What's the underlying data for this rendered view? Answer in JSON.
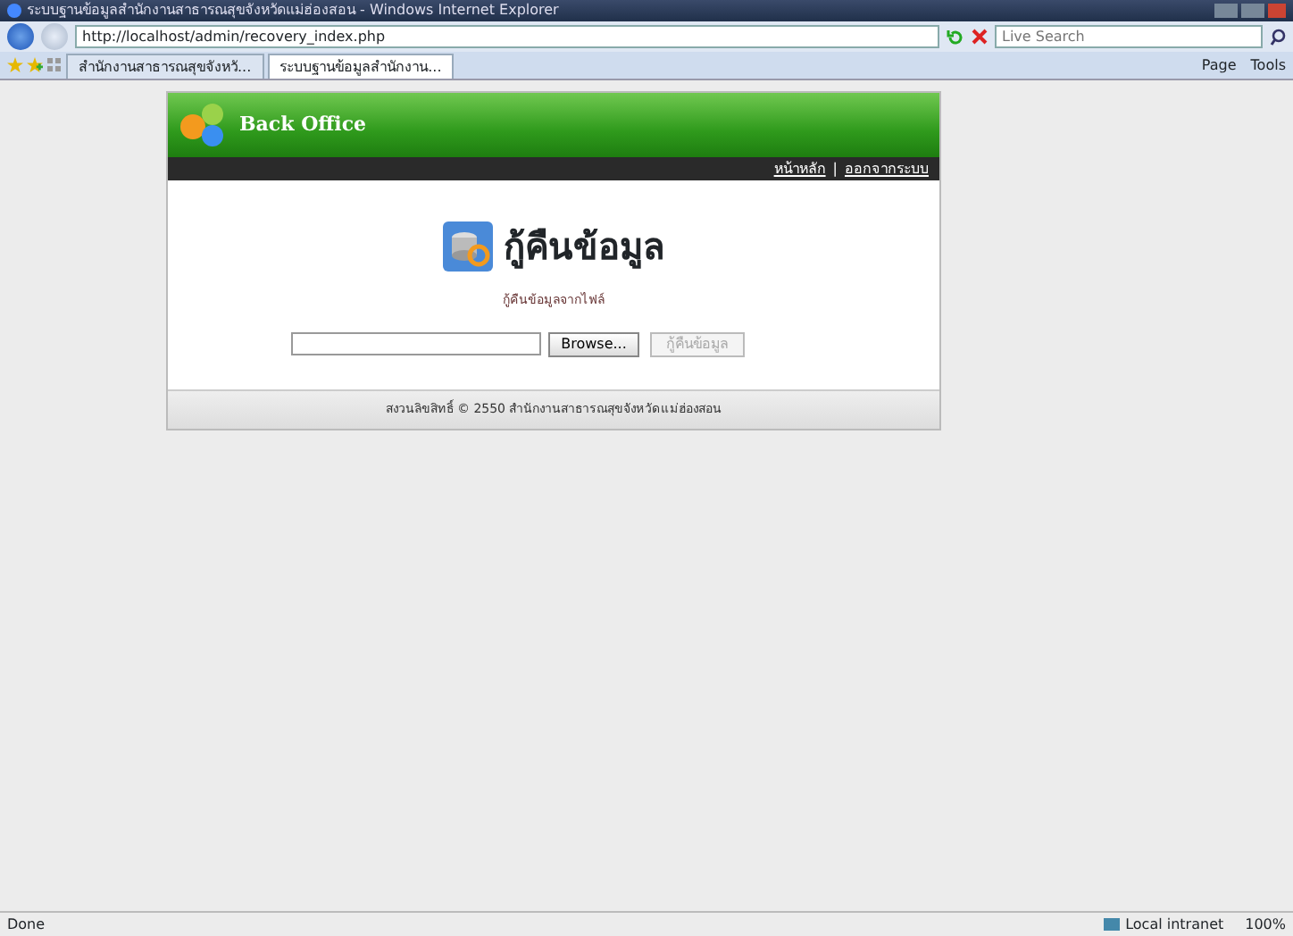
{
  "window": {
    "title": "ระบบฐานข้อมูลสำนักงานสาธารณสุขจังหวัดแม่ฮ่องสอน - Windows Internet Explorer"
  },
  "address_bar": {
    "url": "http://localhost/admin/recovery_index.php",
    "search_placeholder": "Live Search"
  },
  "tabs": [
    {
      "label": "สำนักงานสาธารณสุขจังหวั...",
      "selected": false
    },
    {
      "label": "ระบบฐานข้อมูลสำนักงาน...",
      "selected": true
    }
  ],
  "command_bar": [
    "Page",
    "Tools"
  ],
  "page": {
    "brand": "Back Office",
    "nav_links": [
      "หน้าหลัก",
      "ออกจากระบบ"
    ],
    "nav_separator": "|",
    "heading": "กู้คืนข้อมูล",
    "subtitle": "กู้คืนข้อมูลจากไฟล์",
    "file_input": {
      "button": "Browse..."
    },
    "submit": {
      "label": "กู้คืนข้อมูล",
      "disabled": true
    },
    "footer": "สงวนลิขสิทธิ์ © 2550 สำนักงานสาธารณสุขจังหวัดแม่ฮ่องสอน"
  },
  "status_bar": {
    "status": "Done",
    "zone": "Local intranet",
    "zoom": "100%"
  }
}
